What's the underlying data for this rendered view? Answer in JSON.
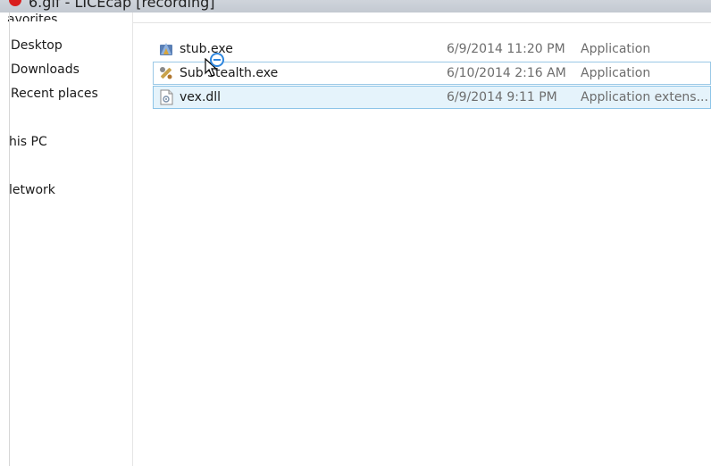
{
  "window": {
    "title": "6.gif - LICEcap [recording]"
  },
  "nav": {
    "favorites_cut": "avorites",
    "items": [
      {
        "label": "Desktop"
      },
      {
        "label": "Downloads"
      },
      {
        "label": "Recent places"
      },
      {
        "label": "his PC"
      },
      {
        "label": "letwork"
      }
    ]
  },
  "files": [
    {
      "name": "stub.exe",
      "date": "6/9/2014 11:20 PM",
      "type": "Application",
      "icon": "exe-app-icon"
    },
    {
      "name": "Sub   Stealth.exe",
      "date": "6/10/2014 2:16 AM",
      "type": "Application",
      "icon": "wrench-app-icon"
    },
    {
      "name": "vex.dll",
      "date": "6/9/2014 9:11 PM",
      "type": "Application extens...",
      "icon": "dll-file-icon"
    }
  ],
  "colors": {
    "selection_bg": "#e5f3fb",
    "selection_border": "#8cc4e8",
    "record_red": "#d91e1e",
    "drag_blue": "#2e86de"
  }
}
